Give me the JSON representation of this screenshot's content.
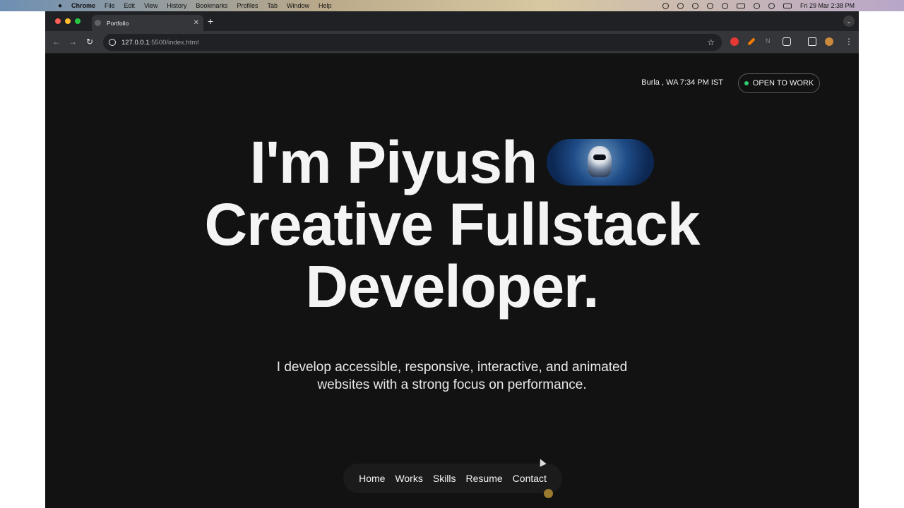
{
  "menubar": {
    "app_name": "Chrome",
    "menus": [
      "File",
      "Edit",
      "View",
      "History",
      "Bookmarks",
      "Profiles",
      "Tab",
      "Window",
      "Help"
    ],
    "clock": "Fri 29 Mar  2:38 PM"
  },
  "browser": {
    "tab_title": "Portfolio",
    "url_host": "127.0.0.1",
    "url_path": ":5500/index.html"
  },
  "page": {
    "location_time": "Burla , WA 7:34 PM IST",
    "status_button": "OPEN TO WORK",
    "status_color": "#2ecc71",
    "hero_line1": "I'm Piyush",
    "hero_line2": "Creative Fullstack",
    "hero_line3": "Developer.",
    "tagline_line1": "I develop accessible, responsive, interactive, and animated",
    "tagline_line2": "websites with a strong focus on performance.",
    "nav": [
      "Home",
      "Works",
      "Skills",
      "Resume",
      "Contact"
    ]
  }
}
